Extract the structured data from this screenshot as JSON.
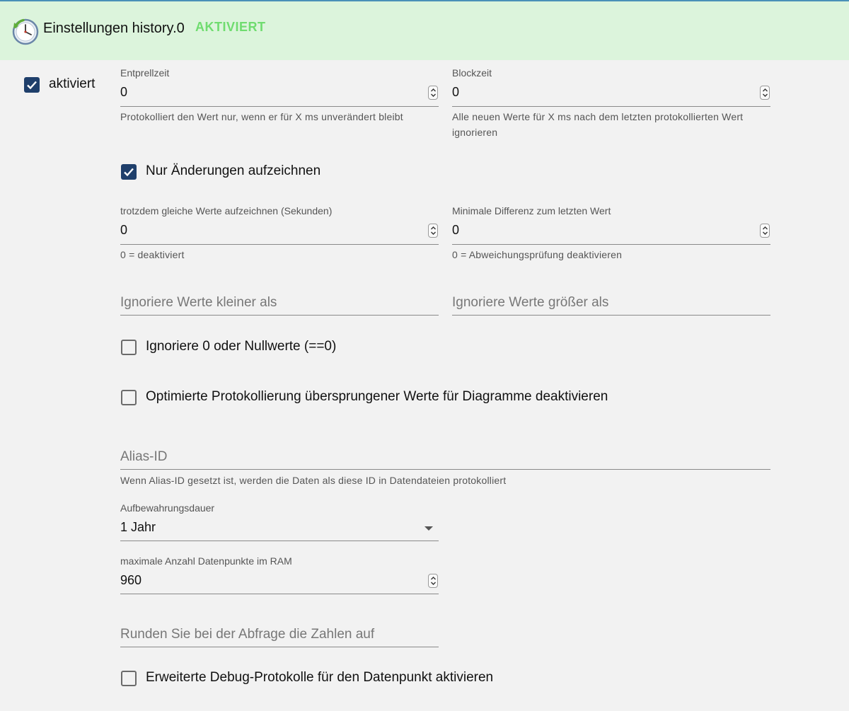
{
  "header": {
    "logo_icon": "clock-history-icon",
    "title": "Einstellungen history.0",
    "status": "AKTIVIERT"
  },
  "enabled": {
    "label": "aktiviert",
    "checked": true
  },
  "debounce": {
    "label": "Entprellzeit",
    "value": "0",
    "helper": "Protokolliert den Wert nur, wenn er für X ms unverändert bleibt"
  },
  "blocktime": {
    "label": "Blockzeit",
    "value": "0",
    "helper": "Alle neuen Werte für X ms nach dem letzten protokollierten Wert ignorieren"
  },
  "changes_only": {
    "label": "Nur Änderungen aufzeichnen",
    "checked": true
  },
  "same_values": {
    "label": "trotzdem gleiche Werte aufzeichnen (Sekunden)",
    "value": "0",
    "helper": "0 = deaktiviert"
  },
  "min_diff": {
    "label": "Minimale Differenz zum letzten Wert",
    "value": "0",
    "helper": "0 = Abweichungsprüfung deaktivieren"
  },
  "ignore_below": {
    "placeholder": "Ignoriere Werte kleiner als"
  },
  "ignore_above": {
    "placeholder": "Ignoriere Werte größer als"
  },
  "ignore_zero": {
    "label": "Ignoriere 0 oder Nullwerte (==0)",
    "checked": false
  },
  "disable_skipped": {
    "label": "Optimierte Protokollierung übersprungener Werte für Diagramme deaktivieren",
    "checked": false
  },
  "alias": {
    "placeholder": "Alias-ID",
    "helper": "Wenn Alias-ID gesetzt ist, werden die Daten als diese ID in Datendateien protokolliert"
  },
  "retention": {
    "label": "Aufbewahrungsdauer",
    "value": "1 Jahr"
  },
  "max_ram": {
    "label": "maximale Anzahl Datenpunkte im RAM",
    "value": "960"
  },
  "round": {
    "placeholder": "Runden Sie bei der Abfrage die Zahlen auf"
  },
  "debug": {
    "label": "Erweiterte Debug-Protokolle für den Datenpunkt aktivieren",
    "checked": false
  }
}
